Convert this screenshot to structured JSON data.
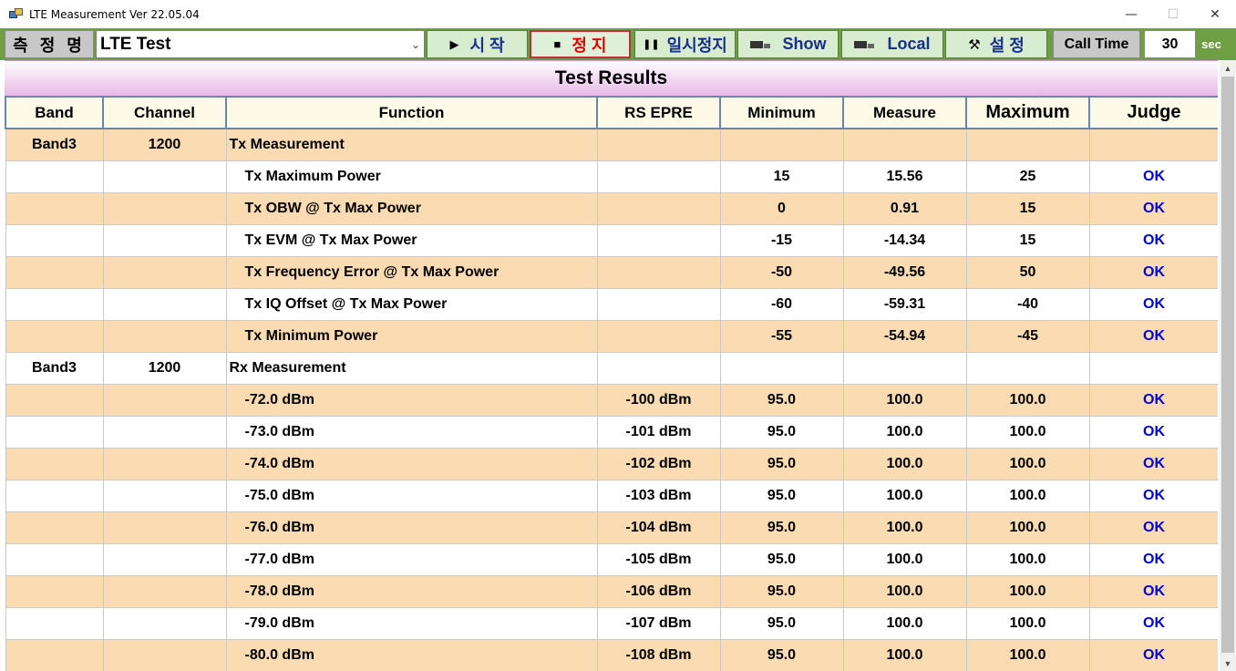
{
  "window": {
    "title": "LTE Measurement Ver 22.05.04",
    "minimize": "—",
    "maximize": "☐",
    "close": "✕"
  },
  "toolbar": {
    "name_label": "측 정 명",
    "test_select": "LTE Test",
    "start_label": "시  작",
    "stop_label": "정  지",
    "pause_label": "일시정지",
    "show_label": "Show",
    "local_label": "Local",
    "settings_label": "설  정",
    "call_time_label": "Call Time",
    "call_time_value": "30",
    "call_time_unit": "sec"
  },
  "results": {
    "title": "Test Results",
    "columns": [
      "Band",
      "Channel",
      "Function",
      "RS EPRE",
      "Minimum",
      "Measure",
      "Maximum",
      "Judge"
    ],
    "rows": [
      {
        "band": "Band3",
        "channel": "1200",
        "function": "Tx Measurement",
        "rs": "",
        "min": "",
        "meas": "",
        "max": "",
        "judge": "",
        "group": true
      },
      {
        "band": "",
        "channel": "",
        "function": "Tx Maximum Power",
        "rs": "",
        "min": "15",
        "meas": "15.56",
        "max": "25",
        "judge": "OK"
      },
      {
        "band": "",
        "channel": "",
        "function": "Tx OBW @ Tx Max Power",
        "rs": "",
        "min": "0",
        "meas": "0.91",
        "max": "15",
        "judge": "OK"
      },
      {
        "band": "",
        "channel": "",
        "function": "Tx EVM @ Tx Max Power",
        "rs": "",
        "min": "-15",
        "meas": "-14.34",
        "max": "15",
        "judge": "OK"
      },
      {
        "band": "",
        "channel": "",
        "function": "Tx Frequency Error @ Tx Max Power",
        "rs": "",
        "min": "-50",
        "meas": "-49.56",
        "max": "50",
        "judge": "OK"
      },
      {
        "band": "",
        "channel": "",
        "function": "Tx IQ Offset @ Tx Max Power",
        "rs": "",
        "min": "-60",
        "meas": "-59.31",
        "max": "-40",
        "judge": "OK"
      },
      {
        "band": "",
        "channel": "",
        "function": "Tx Minimum Power",
        "rs": "",
        "min": "-55",
        "meas": "-54.94",
        "max": "-45",
        "judge": "OK"
      },
      {
        "band": "Band3",
        "channel": "1200",
        "function": "Rx Measurement",
        "rs": "",
        "min": "",
        "meas": "",
        "max": "",
        "judge": "",
        "group": true
      },
      {
        "band": "",
        "channel": "",
        "function": "-72.0 dBm",
        "rs": "-100 dBm",
        "min": "95.0",
        "meas": "100.0",
        "max": "100.0",
        "judge": "OK"
      },
      {
        "band": "",
        "channel": "",
        "function": "-73.0 dBm",
        "rs": "-101 dBm",
        "min": "95.0",
        "meas": "100.0",
        "max": "100.0",
        "judge": "OK"
      },
      {
        "band": "",
        "channel": "",
        "function": "-74.0 dBm",
        "rs": "-102 dBm",
        "min": "95.0",
        "meas": "100.0",
        "max": "100.0",
        "judge": "OK"
      },
      {
        "band": "",
        "channel": "",
        "function": "-75.0 dBm",
        "rs": "-103 dBm",
        "min": "95.0",
        "meas": "100.0",
        "max": "100.0",
        "judge": "OK"
      },
      {
        "band": "",
        "channel": "",
        "function": "-76.0 dBm",
        "rs": "-104 dBm",
        "min": "95.0",
        "meas": "100.0",
        "max": "100.0",
        "judge": "OK"
      },
      {
        "band": "",
        "channel": "",
        "function": "-77.0 dBm",
        "rs": "-105 dBm",
        "min": "95.0",
        "meas": "100.0",
        "max": "100.0",
        "judge": "OK"
      },
      {
        "band": "",
        "channel": "",
        "function": "-78.0 dBm",
        "rs": "-106 dBm",
        "min": "95.0",
        "meas": "100.0",
        "max": "100.0",
        "judge": "OK"
      },
      {
        "band": "",
        "channel": "",
        "function": "-79.0 dBm",
        "rs": "-107 dBm",
        "min": "95.0",
        "meas": "100.0",
        "max": "100.0",
        "judge": "OK"
      },
      {
        "band": "",
        "channel": "",
        "function": "-80.0 dBm",
        "rs": "-108 dBm",
        "min": "95.0",
        "meas": "100.0",
        "max": "100.0",
        "judge": "OK"
      }
    ]
  },
  "colors": {
    "toolbar_bg": "#6f9f45",
    "row_alt": "#fbdcb2",
    "judge_ok": "#0000d8",
    "stop_text": "#e00000",
    "button_text": "#1a2f88"
  }
}
